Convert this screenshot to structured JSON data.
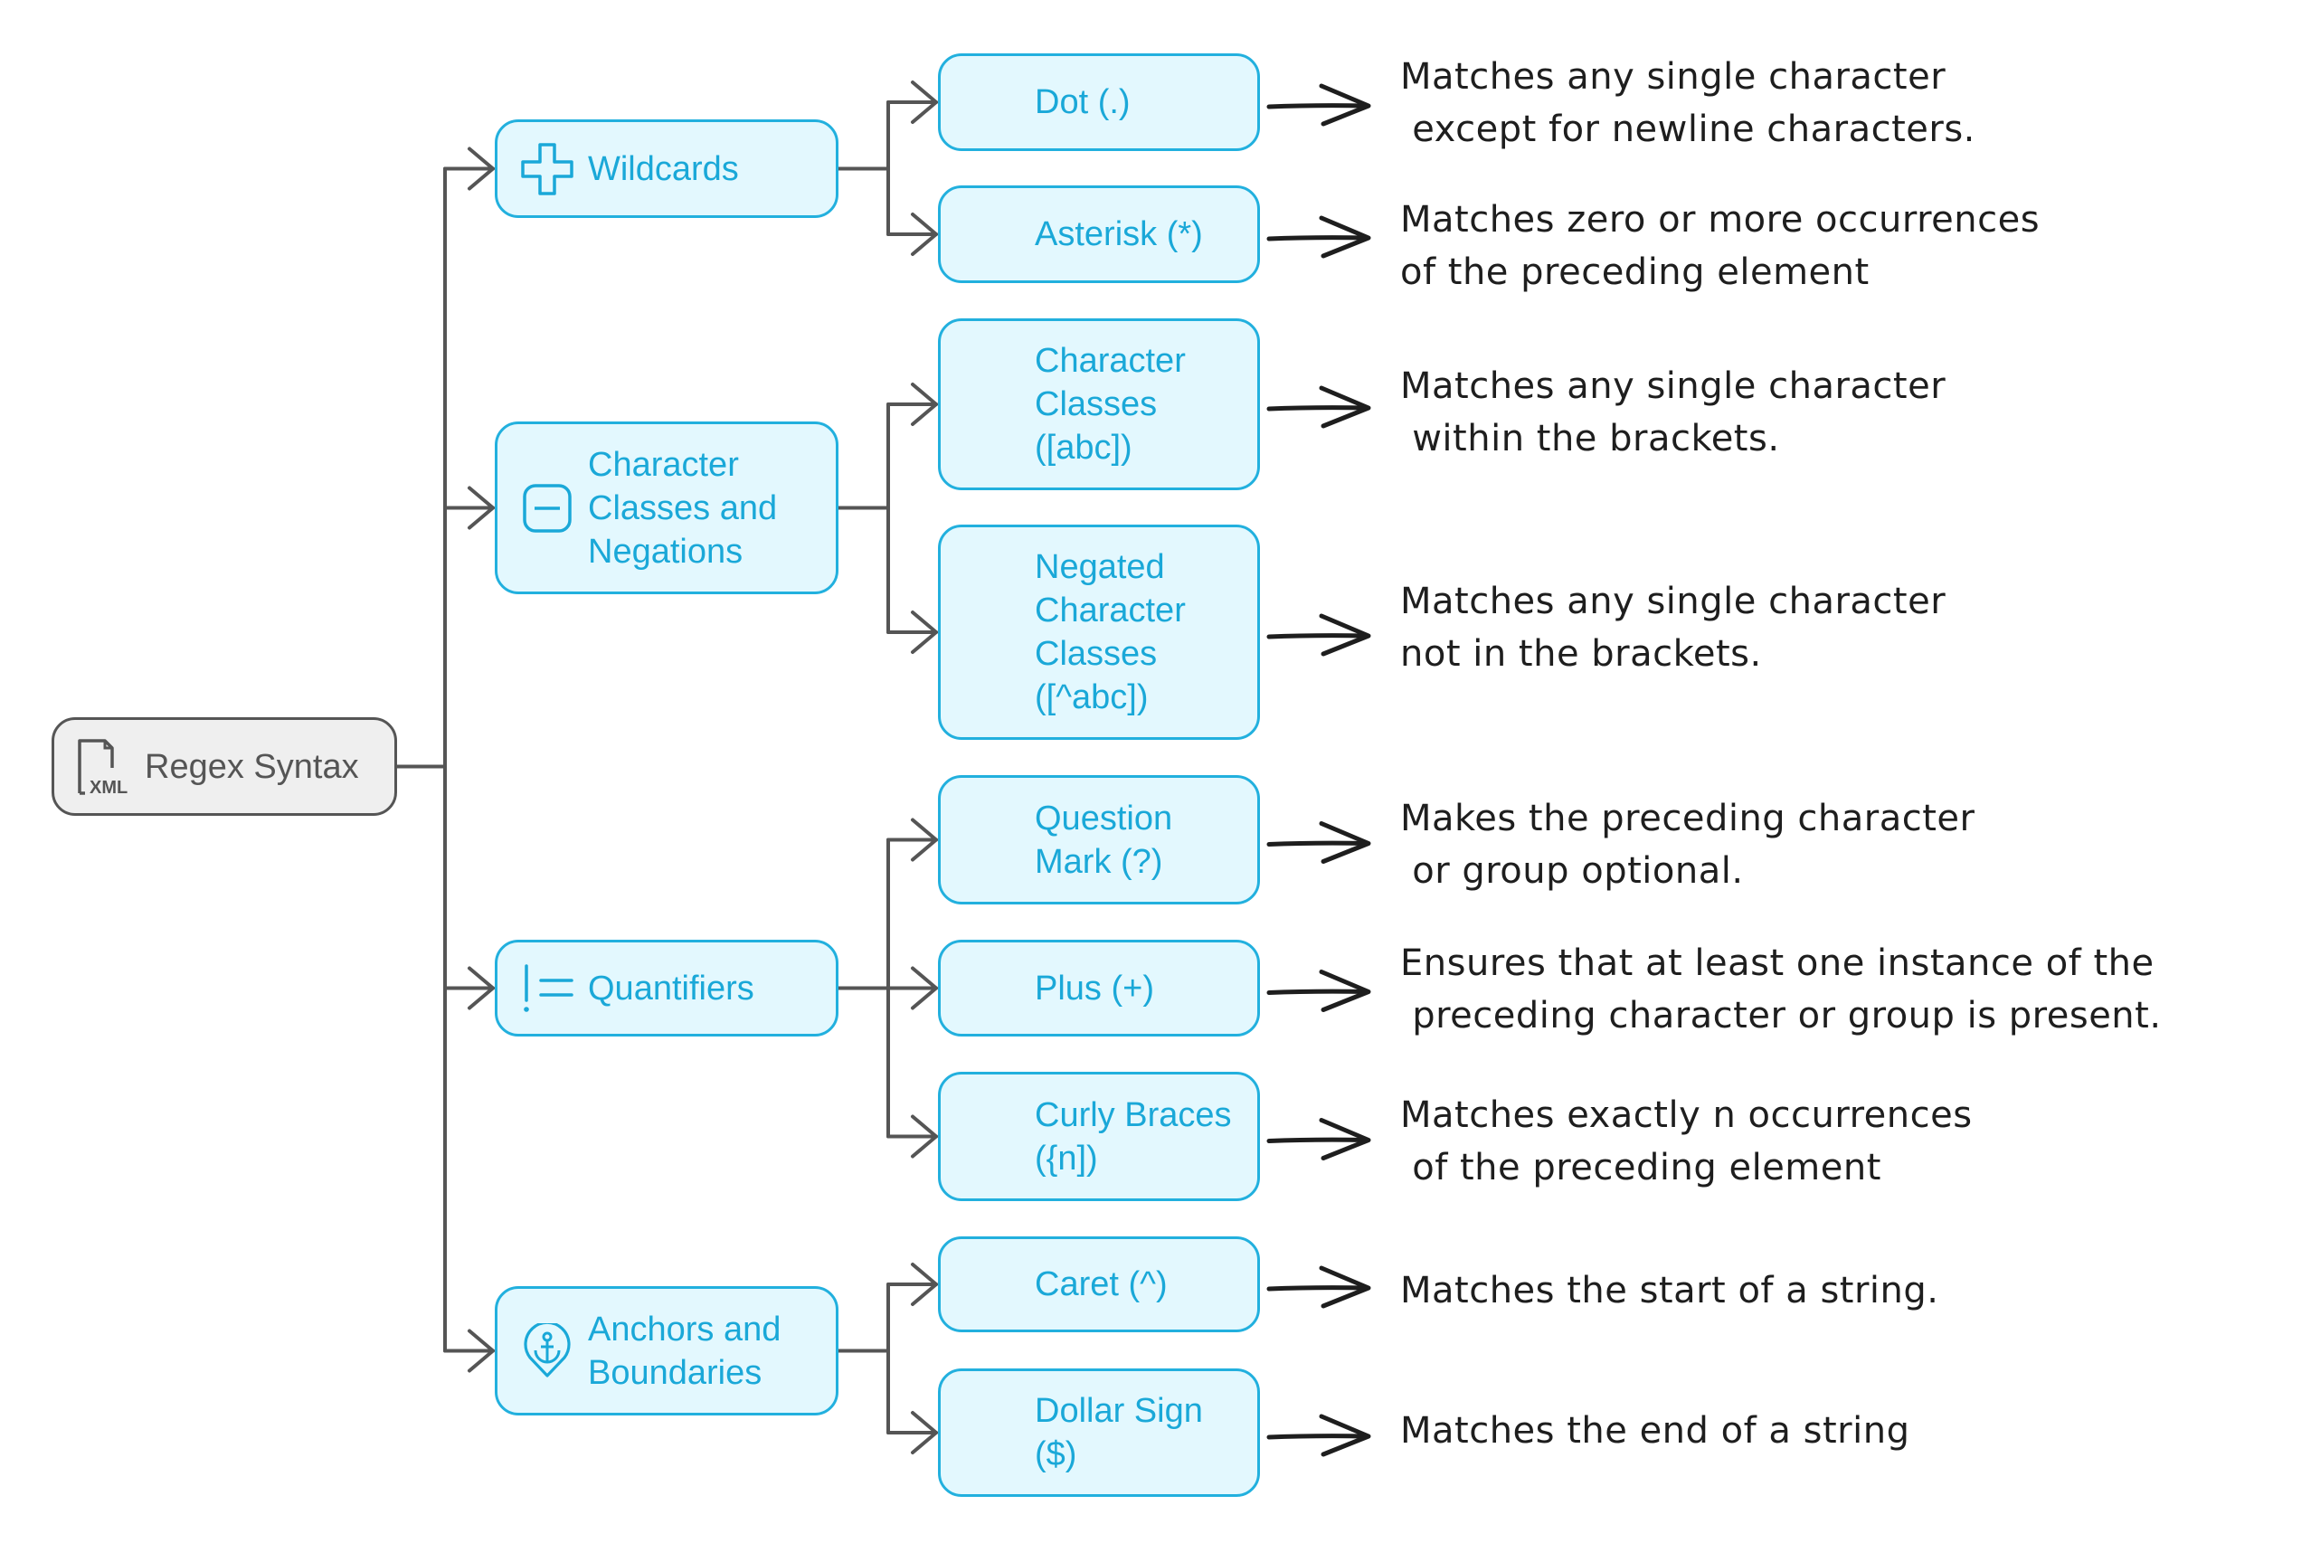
{
  "diagram": {
    "title": "Regex Syntax",
    "root": {
      "label": "Regex Syntax",
      "icon": "xml-file-icon"
    },
    "colors": {
      "node_border": "#22b0de",
      "node_fill": "#e3f8fe",
      "node_text": "#1aa8d8",
      "root_border": "#555555",
      "root_fill": "#efefef",
      "connector": "#555555",
      "description_text": "#1e1e1e"
    },
    "categories": [
      {
        "label": "Wildcards",
        "icon": "plus-outline-icon",
        "items": [
          {
            "label": "Dot (.)",
            "description": "Matches any single character\n except for newline characters."
          },
          {
            "label": "Asterisk (*)",
            "description": "Matches zero or more occurrences\nof the preceding element"
          }
        ]
      },
      {
        "label": "Character\nClasses and\nNegations",
        "icon": "minus-square-icon",
        "items": [
          {
            "label": "Character\nClasses\n([abc])",
            "description": "Matches any single character\n within the brackets."
          },
          {
            "label": "Negated\nCharacter\nClasses\n([^abc])",
            "description": "Matches any single character\nnot in the brackets."
          }
        ]
      },
      {
        "label": "Quantifiers",
        "icon": "exclamation-equals-icon",
        "items": [
          {
            "label": "Question\nMark (?)",
            "description": "Makes the preceding character\n or group optional."
          },
          {
            "label": "Plus (+)",
            "description": "Ensures that at least one instance of the\n preceding character or group is present."
          },
          {
            "label": "Curly Braces\n({n])",
            "description": "Matches exactly n occurrences\n of the preceding element"
          }
        ]
      },
      {
        "label": "Anchors and\nBoundaries",
        "icon": "anchor-pin-icon",
        "items": [
          {
            "label": "Caret (^)",
            "description": "Matches the start of a string."
          },
          {
            "label": "Dollar Sign\n($)",
            "description": "Matches the end of a string"
          }
        ]
      }
    ]
  }
}
